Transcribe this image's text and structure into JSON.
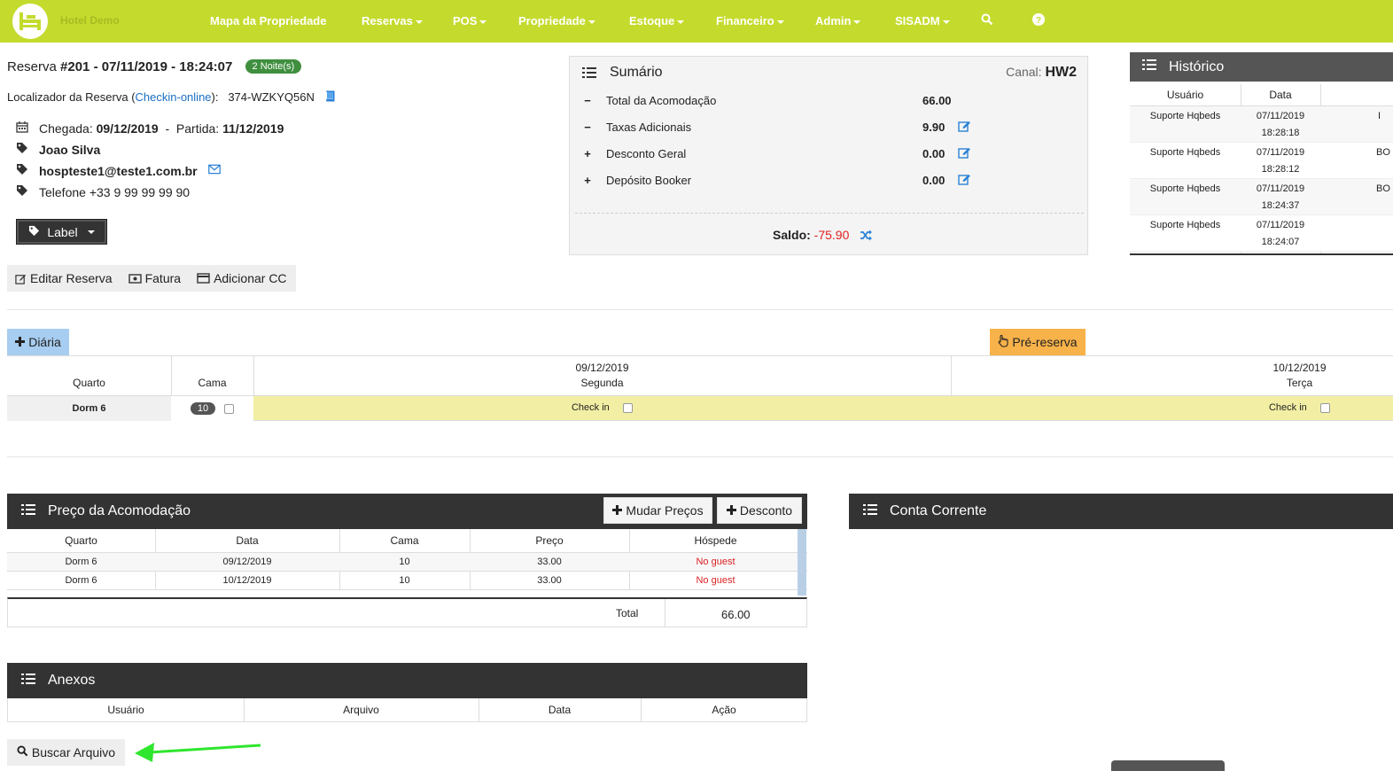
{
  "nav": {
    "brand": "Hotel Demo",
    "items": [
      "Mapa da Propriedade",
      "Reservas",
      "POS",
      "Propriedade",
      "Estoque",
      "Financeiro",
      "Admin",
      "SISADM"
    ]
  },
  "reservation": {
    "title_prefix": "Reserva ",
    "title_bold": "#201 - 07/11/2019 - 18:24:07",
    "nights": "2 Noite(s)",
    "localizador_label": "Localizador da Reserva (",
    "checkin_link": "Checkin-online",
    "localizador_suffix": "):",
    "localizador_code": "374-WZKYQ56N",
    "chegada_label": "Chegada:",
    "chegada": "09/12/2019",
    "partida_label": "Partida:",
    "partida": "11/12/2019",
    "guest_name": "Joao Silva",
    "email": "hospteste1@teste1.com.br",
    "telefone": "Telefone +33 9 99 99 99 90",
    "label_button": "Label"
  },
  "actions": {
    "editar": "Editar Reserva",
    "fatura": "Fatura",
    "adicionar_cc": "Adicionar CC"
  },
  "sumario": {
    "title": "Sumário",
    "canal_label": "Canal:",
    "canal_value": "HW2",
    "rows": [
      {
        "sign": "−",
        "label": "Total da Acomodação",
        "value": "66.00"
      },
      {
        "sign": "−",
        "label": "Taxas Adicionais",
        "value": "9.90"
      },
      {
        "sign": "+",
        "label": "Desconto Geral",
        "value": "0.00"
      },
      {
        "sign": "+",
        "label": "Depósito Booker",
        "value": "0.00"
      }
    ],
    "saldo_label": "Saldo:",
    "saldo_value": "-75.90"
  },
  "historico": {
    "title": "Histórico",
    "columns": [
      "Usuário",
      "Data"
    ],
    "rows": [
      {
        "usuario": "Suporte Hqbeds",
        "data": "07/11/2019",
        "hora": "18:28:18",
        "extra": "I"
      },
      {
        "usuario": "Suporte Hqbeds",
        "data": "07/11/2019",
        "hora": "18:28:12",
        "extra": "BO"
      },
      {
        "usuario": "Suporte Hqbeds",
        "data": "07/11/2019",
        "hora": "18:24:37",
        "extra": "BO"
      },
      {
        "usuario": "Suporte Hqbeds",
        "data": "07/11/2019",
        "hora": "18:24:07",
        "extra": ""
      }
    ]
  },
  "diaria": {
    "add_button": "Diária",
    "pre_reserva_button": "Pré-reserva",
    "col_quarto": "Quarto",
    "col_cama": "Cama",
    "days": [
      {
        "date": "09/12/2019",
        "weekday": "Segunda",
        "status": "Check in"
      },
      {
        "date": "10/12/2019",
        "weekday": "Terça",
        "status": "Check in"
      }
    ],
    "room": "Dorm 6",
    "bed": "10"
  },
  "preco": {
    "title": "Preço da Acomodação",
    "mudar_precos": "Mudar Preços",
    "desconto": "Desconto",
    "columns": [
      "Quarto",
      "Data",
      "Cama",
      "Preço",
      "Hóspede"
    ],
    "rows": [
      {
        "quarto": "Dorm 6",
        "data": "09/12/2019",
        "cama": "10",
        "preco": "33.00",
        "hospede": "No guest"
      },
      {
        "quarto": "Dorm 6",
        "data": "10/12/2019",
        "cama": "10",
        "preco": "33.00",
        "hospede": "No guest"
      }
    ],
    "total_label": "Total",
    "total_value": "66.00"
  },
  "conta": {
    "title": "Conta Corrente"
  },
  "anexos": {
    "title": "Anexos",
    "columns": [
      "Usuário",
      "Arquivo",
      "Data",
      "Ação"
    ],
    "buscar": "Buscar Arquivo"
  },
  "colors": {
    "nav_bg": "#c4db2e",
    "dark_header": "#333333",
    "accent_blue": "#1b6fc2",
    "negative_red": "#e02020",
    "arrow_green": "#2ee62e"
  }
}
